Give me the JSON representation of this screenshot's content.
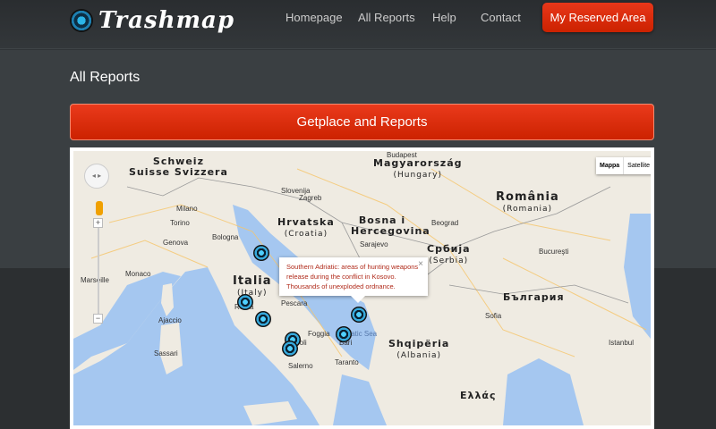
{
  "header": {
    "logo_text": "Trashmap",
    "nav": [
      "Homepage",
      "All Reports",
      "Help",
      "Contact"
    ],
    "reserved_label": "My Reserved Area"
  },
  "page": {
    "title": "All Reports",
    "getplace_label": "Getplace and Reports"
  },
  "map": {
    "map_type": [
      "Mappa",
      "Satellite"
    ],
    "zoom_in": "+",
    "zoom_out": "−",
    "popup": {
      "text": "Southern Adriatic: areas of hunting weapons release during the conflict in Kosovo. Thousands of unexploded ordnance.",
      "close": "×"
    },
    "countries": [
      {
        "name": "Schweiz",
        "sub": "Suisse Svizzera"
      },
      {
        "name": "Magyarország",
        "sub": "(Hungary)"
      },
      {
        "name": "România",
        "sub": "(Romania)"
      },
      {
        "name": "Hrvatska",
        "sub": "(Croatia)"
      },
      {
        "name": "Bosna i Hercegovina",
        "sub": ""
      },
      {
        "name": "Србија",
        "sub": "(Serbia)"
      },
      {
        "name": "Italia",
        "sub": "(Italy)"
      },
      {
        "name": "Shqipëria",
        "sub": "(Albania)"
      },
      {
        "name": "България",
        "sub": ""
      },
      {
        "name": "Ελλάς",
        "sub": ""
      }
    ],
    "cities": [
      "Torino",
      "Genova",
      "Monaco",
      "Marseille",
      "Milano",
      "Bologna",
      "Roma",
      "Napoli",
      "Pescara",
      "Foggia",
      "Bari",
      "Taranto",
      "Salerno",
      "Zagreb",
      "Sarajevo",
      "Beograd",
      "Budapest",
      "Bucureşti",
      "Sofia",
      "Istanbul",
      "Adriatic Sea",
      "Slovenija",
      "Sassari",
      "Ajaccio"
    ]
  }
}
